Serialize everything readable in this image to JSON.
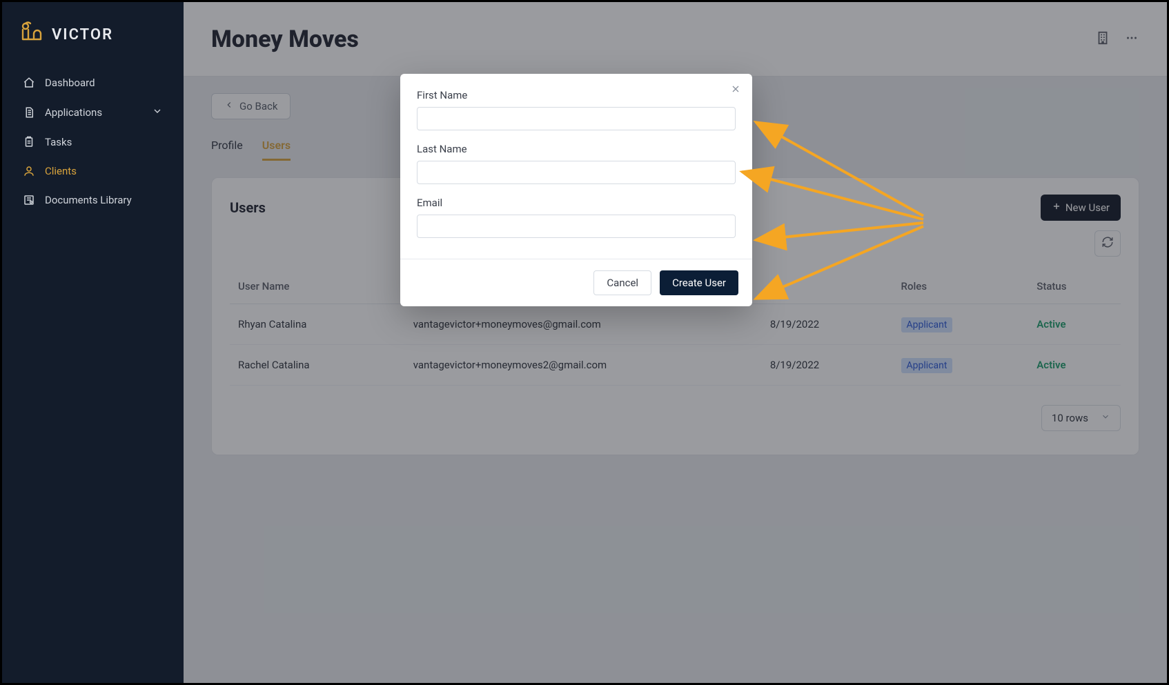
{
  "brand": {
    "name": "VICTOR"
  },
  "sidebar": {
    "items": [
      {
        "label": "Dashboard"
      },
      {
        "label": "Applications"
      },
      {
        "label": "Tasks"
      },
      {
        "label": "Clients"
      },
      {
        "label": "Documents Library"
      }
    ]
  },
  "header": {
    "title": "Money Moves"
  },
  "actions": {
    "go_back": "Go Back"
  },
  "tabs": [
    {
      "label": "Profile"
    },
    {
      "label": "Users"
    }
  ],
  "users_card": {
    "title": "Users",
    "new_user": "New User",
    "columns": {
      "user_name": "User Name",
      "email": "",
      "created": "",
      "roles": "Roles",
      "status": "Status"
    },
    "rows": [
      {
        "name": "Rhyan Catalina",
        "email": "vantagevictor+moneymoves@gmail.com",
        "created": "8/19/2022",
        "role": "Applicant",
        "status": "Active"
      },
      {
        "name": "Rachel Catalina",
        "email": "vantagevictor+moneymoves2@gmail.com",
        "created": "8/19/2022",
        "role": "Applicant",
        "status": "Active"
      }
    ],
    "rows_select": "10 rows"
  },
  "modal": {
    "first_name_label": "First Name",
    "last_name_label": "Last Name",
    "email_label": "Email",
    "cancel": "Cancel",
    "submit": "Create User"
  },
  "colors": {
    "accent": "#d8a33c",
    "sidebar_bg": "#131c2b",
    "annotation": "#f5a623"
  }
}
